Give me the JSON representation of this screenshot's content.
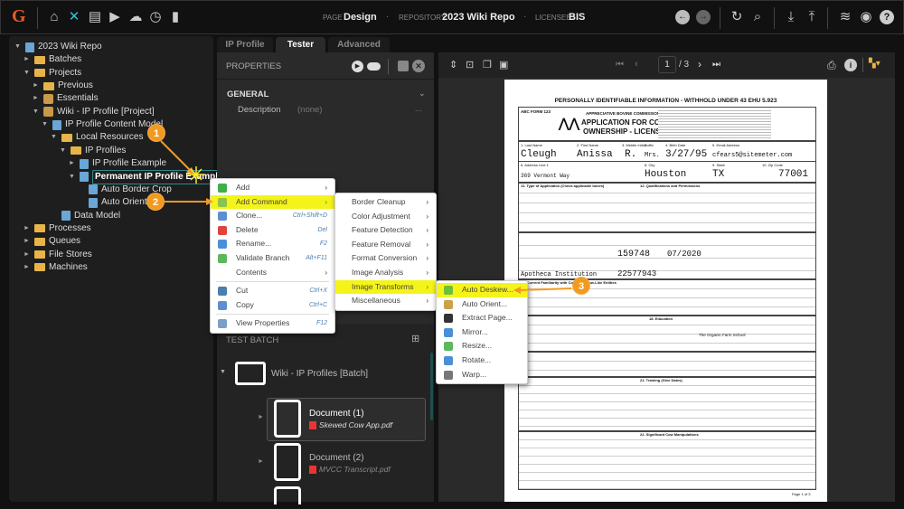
{
  "header": {
    "page_label": "PAGE",
    "page_value": "Design",
    "repo_label": "REPOSITORY",
    "repo_value": "2023 Wiki Repo",
    "licensee_label": "LICENSEE",
    "licensee_value": "BIS",
    "logo": "G",
    "accent": "#2ec4d6"
  },
  "tree": [
    {
      "label": "2023 Wiki Repo",
      "level": 0,
      "arrow": "▼",
      "icon": "repo"
    },
    {
      "label": "Batches",
      "level": 1,
      "arrow": "►",
      "icon": "folder"
    },
    {
      "label": "Projects",
      "level": 1,
      "arrow": "▼",
      "icon": "folder"
    },
    {
      "label": "Previous",
      "level": 2,
      "arrow": "►",
      "icon": "folder"
    },
    {
      "label": "Essentials",
      "level": 2,
      "arrow": "►",
      "icon": "package"
    },
    {
      "label": "Wiki - IP Profile [Project]",
      "level": 2,
      "arrow": "▼",
      "icon": "package"
    },
    {
      "label": "IP Profile Content Model",
      "level": 3,
      "arrow": "▼",
      "icon": "content-model"
    },
    {
      "label": "Local Resources",
      "level": 4,
      "arrow": "▼",
      "icon": "folder"
    },
    {
      "label": "IP Profiles",
      "level": 5,
      "arrow": "▼",
      "icon": "folder"
    },
    {
      "label": "IP Profile Example",
      "level": 6,
      "arrow": "►",
      "icon": "profile"
    },
    {
      "label": "Permanent IP Profile Example",
      "level": 6,
      "arrow": "▼",
      "icon": "profile",
      "selected": true
    },
    {
      "label": "Auto Border Crop",
      "level": 7,
      "arrow": "",
      "icon": "command"
    },
    {
      "label": "Auto Orient",
      "level": 7,
      "arrow": "",
      "icon": "command"
    },
    {
      "label": "Data Model",
      "level": 4,
      "arrow": "",
      "icon": "data-model"
    },
    {
      "label": "Processes",
      "level": 1,
      "arrow": "►",
      "icon": "folder"
    },
    {
      "label": "Queues",
      "level": 1,
      "arrow": "►",
      "icon": "folder"
    },
    {
      "label": "File Stores",
      "level": 1,
      "arrow": "►",
      "icon": "folder"
    },
    {
      "label": "Machines",
      "level": 1,
      "arrow": "►",
      "icon": "folder"
    }
  ],
  "tabs": [
    "IP Profile",
    "Tester",
    "Advanced"
  ],
  "properties": {
    "title": "PROPERTIES",
    "section": "GENERAL",
    "description_label": "Description",
    "description_value": "(none)",
    "ellipsis": "..."
  },
  "test_batch": {
    "title": "TEST BATCH",
    "batch_name": "Wiki - IP Profiles [Batch]",
    "documents": [
      {
        "name": "Document (1)",
        "file": "Skewed Cow App.pdf"
      },
      {
        "name": "Document (2)",
        "file": "MVCC Transcript.pdf"
      }
    ]
  },
  "viewer": {
    "page": "1",
    "total": "/ 3"
  },
  "context_menu": [
    {
      "label": "Add",
      "shortcut": "",
      "submenu": true,
      "icon": "add",
      "color": "#3fae49"
    },
    {
      "label": "Add Command",
      "shortcut": "",
      "submenu": true,
      "icon": "add-command",
      "color": "#8bc34a",
      "highlight": true
    },
    {
      "label": "Clone...",
      "shortcut": "Ctrl+Shift+D",
      "icon": "clone",
      "color": "#5b8fd1"
    },
    {
      "label": "Delete",
      "shortcut": "Del",
      "icon": "delete",
      "color": "#e0433b"
    },
    {
      "label": "Rename...",
      "shortcut": "F2",
      "icon": "rename",
      "color": "#4a90d9"
    },
    {
      "label": "Validate Branch",
      "shortcut": "Alt+F11",
      "icon": "validate",
      "color": "#5cb85c"
    },
    {
      "label": "Contents",
      "shortcut": "",
      "submenu": true,
      "icon": "",
      "color": ""
    },
    {
      "label": "Cut",
      "shortcut": "Ctrl+X",
      "icon": "cut",
      "color": "#4a7fb0",
      "sep_before": true
    },
    {
      "label": "Copy",
      "shortcut": "Ctrl+C",
      "icon": "copy",
      "color": "#5b8fd1"
    },
    {
      "label": "View Properties",
      "shortcut": "F12",
      "icon": "properties",
      "color": "#7aa0c8",
      "sep_before": true
    }
  ],
  "command_menu": [
    {
      "label": "Border Cleanup"
    },
    {
      "label": "Color Adjustment"
    },
    {
      "label": "Feature Detection"
    },
    {
      "label": "Feature Removal"
    },
    {
      "label": "Format Conversion"
    },
    {
      "label": "Image Analysis"
    },
    {
      "label": "Image Transforms",
      "highlight": true
    },
    {
      "label": "Miscellaneous"
    }
  ],
  "transform_menu": [
    {
      "label": "Auto Deskew...",
      "icon": "deskew",
      "color": "#6cbf3c",
      "highlight": true
    },
    {
      "label": "Auto Orient...",
      "icon": "orient",
      "color": "#c9a24a"
    },
    {
      "label": "Extract Page...",
      "icon": "extract",
      "color": "#333"
    },
    {
      "label": "Mirror...",
      "icon": "mirror",
      "color": "#4a90d9"
    },
    {
      "label": "Resize...",
      "icon": "resize",
      "color": "#5cb85c"
    },
    {
      "label": "Rotate...",
      "icon": "rotate",
      "color": "#4a90d9"
    },
    {
      "label": "Warp...",
      "icon": "warp",
      "color": "#777"
    }
  ],
  "callouts": [
    "1",
    "2",
    "3"
  ],
  "document": {
    "banner": "PERSONALLY IDENTIFIABLE INFORMATION - WITHHOLD UNDER 43 EHU 5.923",
    "form_no": "ABC FORM 123",
    "agency": "APPRECIATIVE BOVINE COMMISSION",
    "title1": "APPLICATION FOR COW",
    "title2": "OWNERSHIP - LICENSEE",
    "last_name_label": "1. Last Name",
    "last_name": "Cleugh",
    "first_name_label": "2. First Name",
    "first_name": "Anissa",
    "middle_label": "3. Middle Initial",
    "middle": "R.",
    "suffix_label": "Suffix",
    "suffix": "Mrs.",
    "dob_label": "4. Birth Date",
    "dob": "3/27/95",
    "email_label": "5. Email Address",
    "email": "cfears5@sitemeter.com",
    "address_label": "6. Address Line 1",
    "address": "369 Vermont Way",
    "city_label": "8. City",
    "city": "Houston",
    "state_label": "9. State",
    "state": "TX",
    "zip_label": "10. Zip Code",
    "zip": "77001",
    "section11": "11. Type of Application (Check applicable boxes)",
    "section12": "12. Qualifications and Permissions",
    "dealer_no": "159748",
    "license_date": "07/2020",
    "facility": "Apotheca Institution",
    "facility_no": "22577943",
    "school": "The Organic Farm School",
    "section16": "16. Current Familiarity with Cows and Cow-Like Entities",
    "section18": "18. Education",
    "section21": "21. Training (Give Dates)",
    "section22": "22. Significant Cow Manipulations",
    "page_footer": "Page 1 of 3"
  }
}
